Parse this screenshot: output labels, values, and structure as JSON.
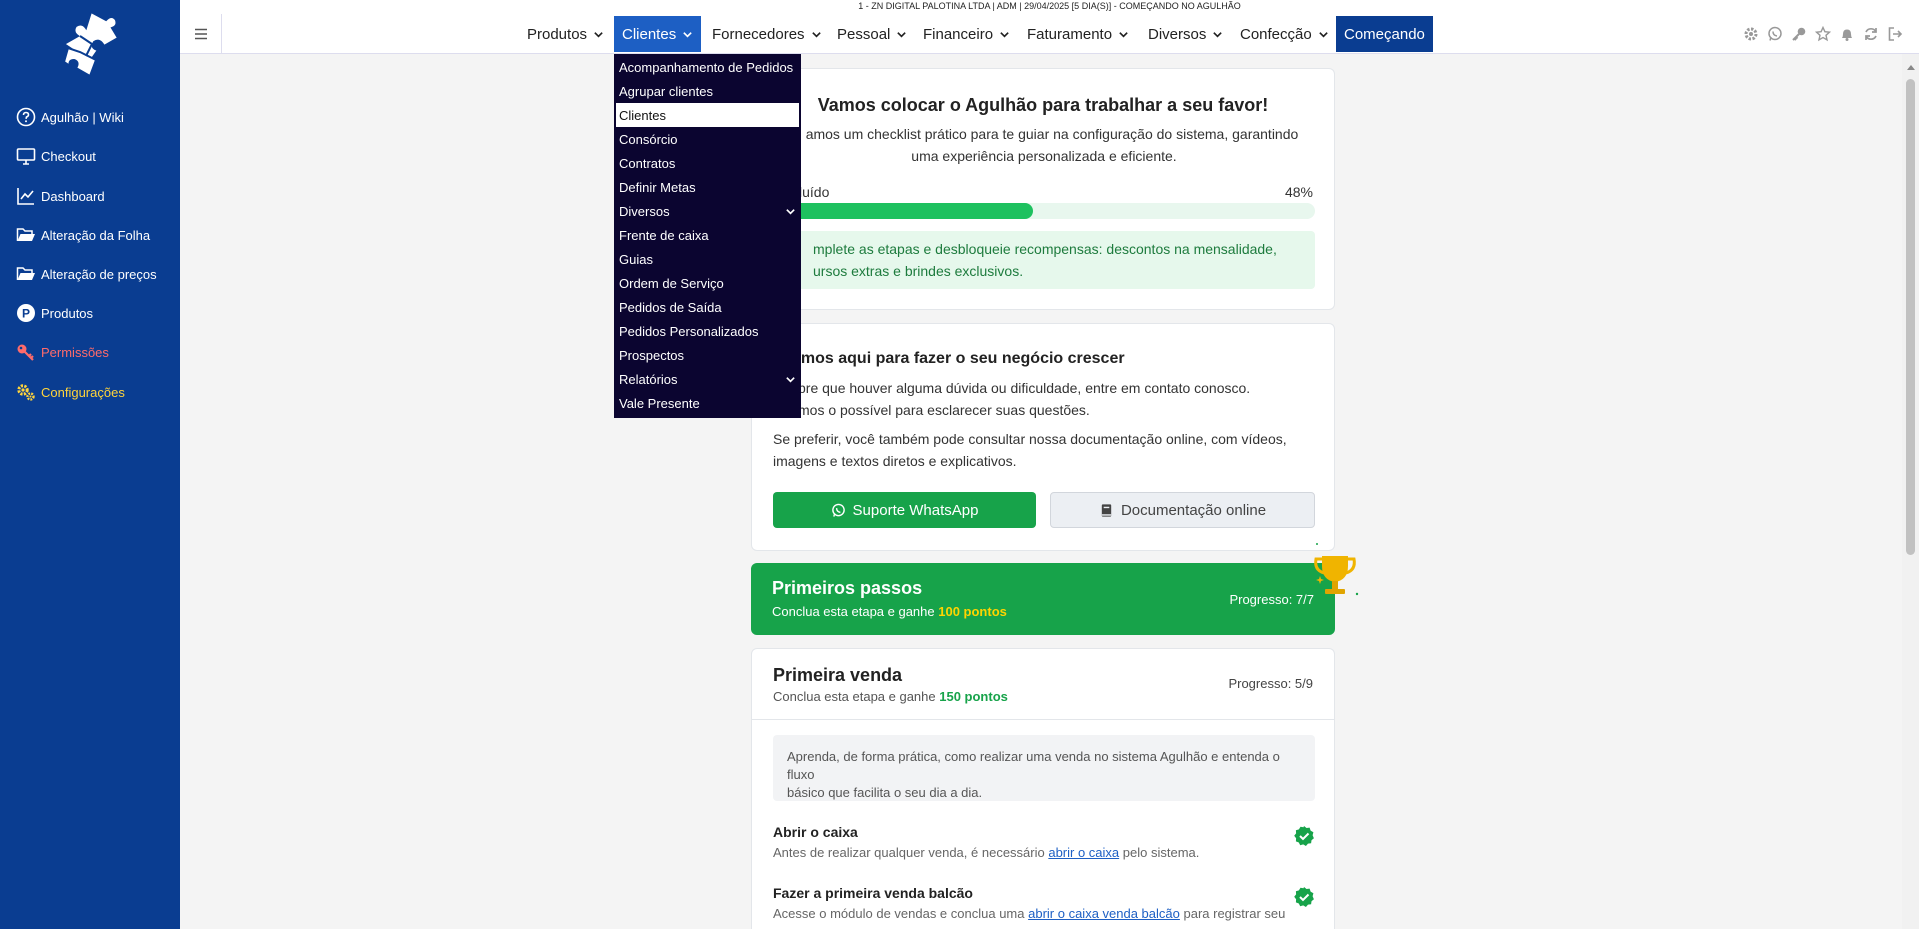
{
  "top_info": "1 - ZN DIGITAL PALOTINA LTDA     | ADM | 29/04/2025 [5 DIA(S)] - COMEÇANDO NO AGULHÃO",
  "sidebar": {
    "items": [
      {
        "label": "Agulhão | Wiki",
        "icon": "question-circle-icon"
      },
      {
        "label": "Checkout",
        "icon": "monitor-icon"
      },
      {
        "label": "Dashboard",
        "icon": "chart-line-icon"
      },
      {
        "label": "Alteração da Folha",
        "icon": "folder-open-icon"
      },
      {
        "label": "Alteração de preços",
        "icon": "folder-open-icon"
      },
      {
        "label": "Produtos",
        "icon": "p-circle-icon"
      },
      {
        "label": "Permissões",
        "icon": "key-icon"
      },
      {
        "label": "Configurações",
        "icon": "gears-icon"
      }
    ]
  },
  "nav": {
    "items": [
      "Produtos",
      "Clientes",
      "Fornecedores",
      "Pessoal",
      "Financeiro",
      "Faturamento",
      "Diversos",
      "Confecção"
    ],
    "cta": "Começando",
    "active": "Clientes"
  },
  "dropdown": {
    "items": [
      "Acompanhamento de Pedidos",
      "Agrupar clientes",
      "Clientes",
      "Consórcio",
      "Contratos",
      "Definir Metas",
      "Diversos",
      "Frente de caixa",
      "Guias",
      "Ordem de Serviço",
      "Pedidos de Saída",
      "Pedidos Personalizados",
      "Prospectos",
      "Relatórios",
      "Vale Presente"
    ],
    "selected": "Clientes",
    "submenus": [
      "Diversos",
      "Relatórios"
    ]
  },
  "welcome": {
    "title": "Vamos colocar o Agulhão para trabalhar a seu favor!",
    "desc_line1": "amos um checklist prático para te guiar na configuração do sistema, garantindo",
    "desc_line2": "uma experiência personalizada e eficiente.",
    "progress_label": "cluído",
    "progress_value": "48%",
    "progress_fraction": 0.48,
    "alert_line1": "mplete as etapas e desbloqueie recompensas: descontos na mensalidade,",
    "alert_line2": "ursos extras e brindes exclusivos."
  },
  "support": {
    "title": "amos aqui para fazer o seu negócio crescer",
    "line1": "pre que houver alguma dúvida ou dificuldade, entre em contato conosco.",
    "line2": "mos o possível para esclarecer suas questões.",
    "line3": "Se preferir, você também pode consultar nossa documentação online, com vídeos,",
    "line4": "imagens e textos diretos e explicativos.",
    "whatsapp_button": "Suporte WhatsApp",
    "docs_button": "Documentação online"
  },
  "first_steps": {
    "title": "Primeiros passos",
    "subtitle": "Conclua esta etapa e ganhe ",
    "points": "100 pontos",
    "progress": "Progresso: 7/7"
  },
  "first_sale": {
    "title": "Primeira venda",
    "subtitle": "Conclua esta etapa e ganhe ",
    "points": "150 pontos",
    "progress": "Progresso: 5/9",
    "intro_line1": "Aprenda, de forma prática, como realizar uma venda no sistema Agulhão e entenda o fluxo",
    "intro_line2": "básico que facilita o seu dia a dia.",
    "tasks": [
      {
        "title": "Abrir o caixa",
        "desc_before": "Antes de realizar qualquer venda, é necessário ",
        "link": "abrir o caixa",
        "desc_after": " pelo sistema."
      },
      {
        "title": "Fazer a primeira venda balcão",
        "desc_before": "Acesse o módulo de vendas e conclua uma ",
        "link": "abrir o caixa venda balcão",
        "desc_after": " para registrar seu"
      }
    ]
  },
  "colors": {
    "sidebar": "#0a3d91",
    "accent": "#1d5fc4",
    "success": "#17a34a",
    "dropdown": "#0b0530",
    "points": "#ffd400"
  }
}
